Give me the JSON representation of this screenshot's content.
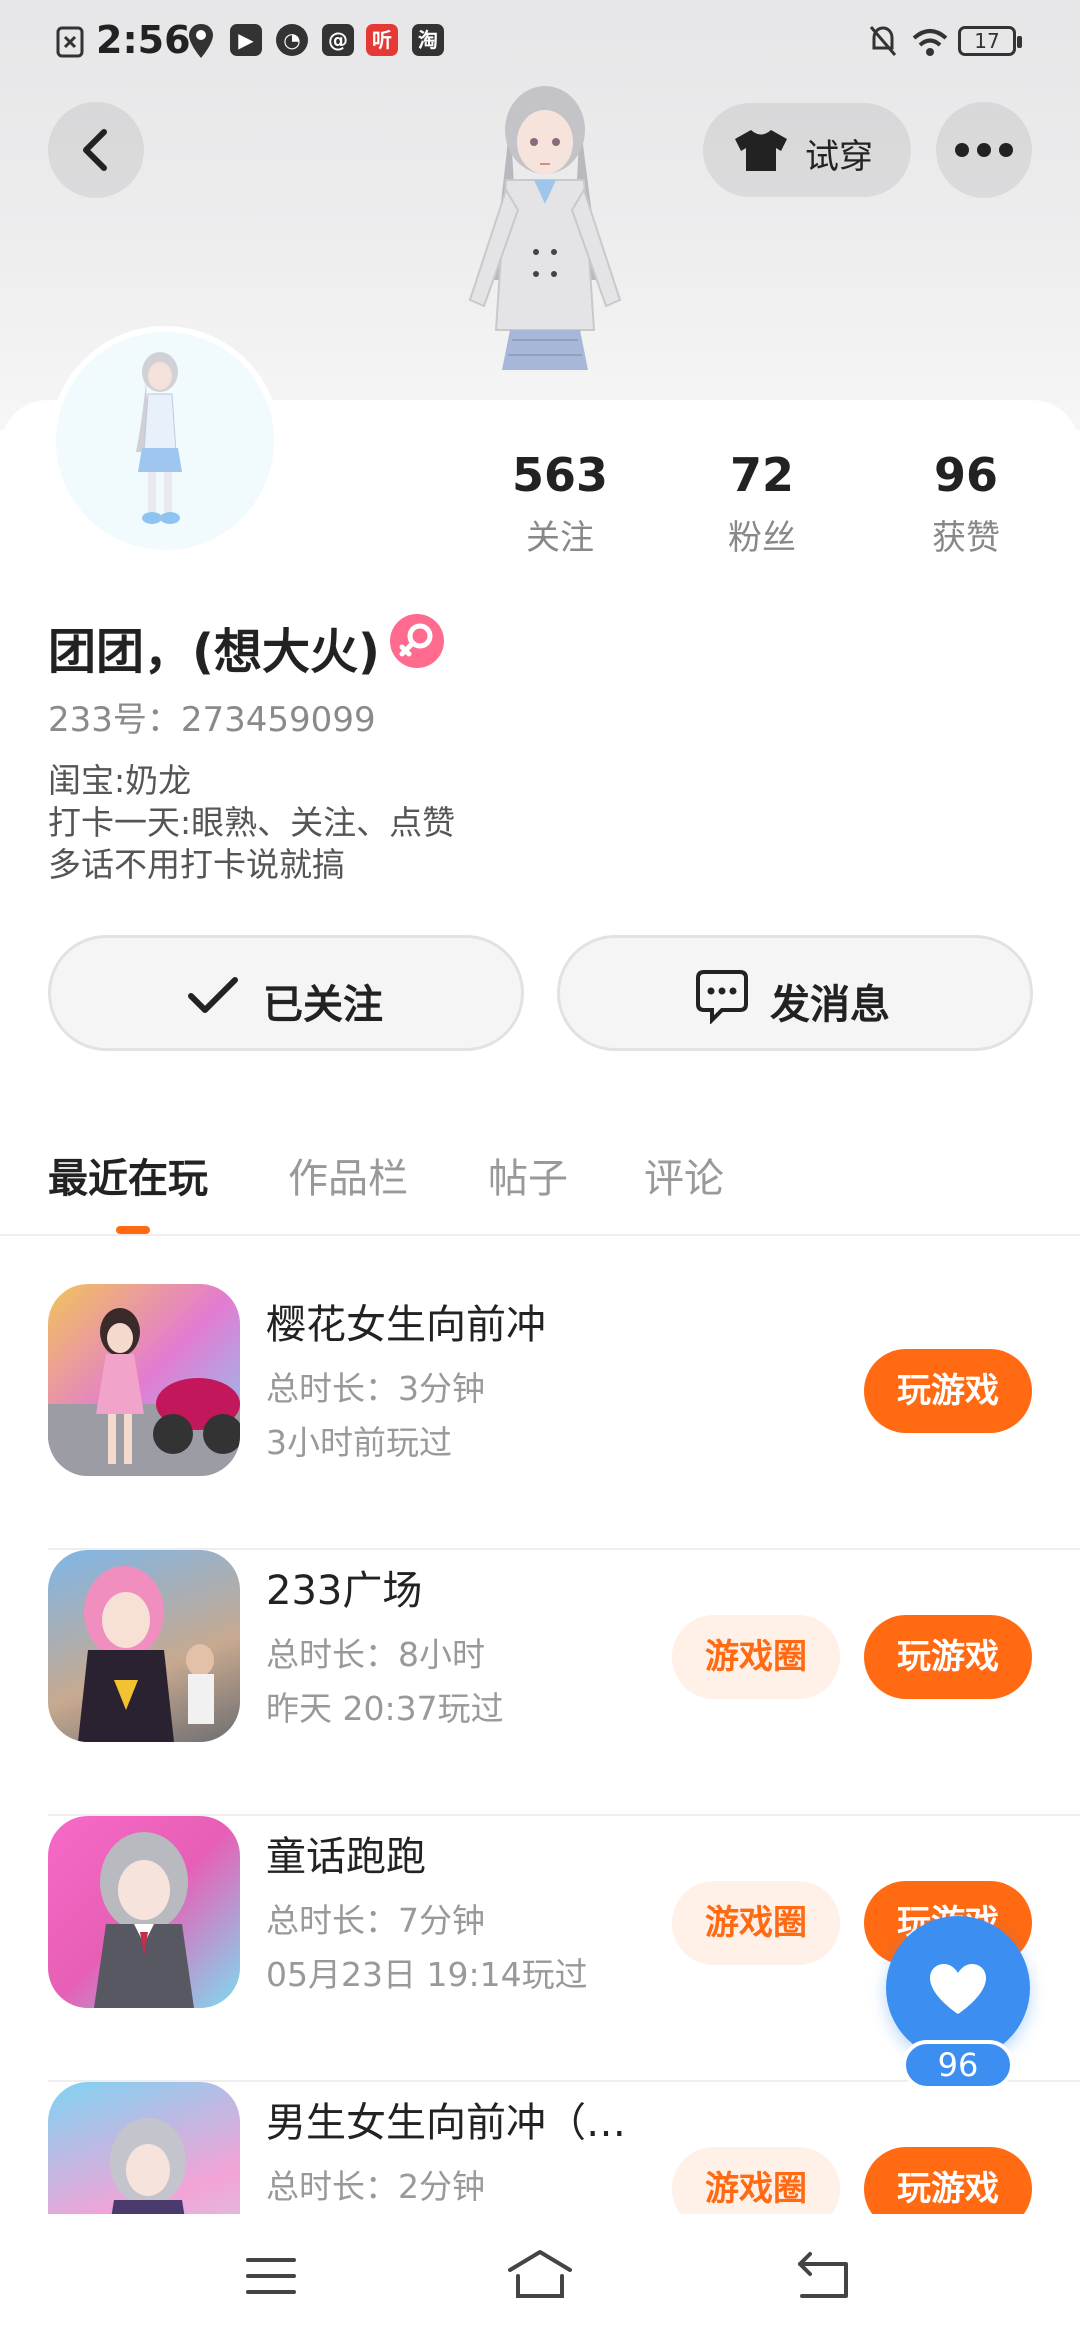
{
  "status_bar": {
    "time": "2:56",
    "icons": [
      "sim-error-icon",
      "du-icon",
      "location-icon",
      "play-icon",
      "speed-icon",
      "qq-icon",
      "ting-icon",
      "taobao-icon",
      "mute-icon",
      "wifi-icon"
    ],
    "app_icon_labels": {
      "ting": "听",
      "taobao": "淘"
    },
    "battery": "17"
  },
  "header": {
    "back_icon": "chevron-left-icon",
    "try_on_label": "试穿",
    "try_on_icon": "tshirt-icon",
    "more_icon": "more-dots-icon"
  },
  "profile": {
    "stats": [
      {
        "value": "563",
        "label": "关注"
      },
      {
        "value": "72",
        "label": "粉丝"
      },
      {
        "value": "96",
        "label": "获赞"
      }
    ],
    "nickname": "团团，(想大火)",
    "gender_icon": "female-icon",
    "uid": "233号：273459099",
    "bio": [
      "闺宝:奶龙",
      "打卡一天:眼熟、关注、点赞",
      "多话不用打卡说就搞"
    ]
  },
  "actions": {
    "follow_label": "已关注",
    "message_label": "发消息"
  },
  "tabs": [
    {
      "label": "最近在玩",
      "active": true
    },
    {
      "label": "作品栏",
      "active": false
    },
    {
      "label": "帖子",
      "active": false
    },
    {
      "label": "评论",
      "active": false
    }
  ],
  "games": [
    {
      "name": "樱花女生向前冲",
      "duration": "总时长：3分钟",
      "last_played": "3小时前玩过",
      "play_label": "玩游戏",
      "circle_label": ""
    },
    {
      "name": "233广场",
      "duration": "总时长：8小时",
      "last_played": "昨天 20:37玩过",
      "play_label": "玩游戏",
      "circle_label": "游戏圈"
    },
    {
      "name": "童话跑跑",
      "duration": "总时长：7分钟",
      "last_played": "05月23日 19:14玩过",
      "play_label": "玩游戏",
      "circle_label": "游戏圈"
    },
    {
      "name": "男生女生向前冲（…",
      "duration": "总时长：2分钟",
      "last_played": "",
      "play_label": "玩游戏",
      "circle_label": "游戏圈"
    }
  ],
  "like_fab": {
    "count": "96",
    "icon": "heart-icon"
  },
  "nav_bar": {
    "icons": [
      "menu-icon",
      "home-icon",
      "back-nav-icon"
    ]
  },
  "colors": {
    "accent": "#ff6a13",
    "like_blue": "#3c8ef0",
    "gender_pink": "#ff6b8e"
  }
}
